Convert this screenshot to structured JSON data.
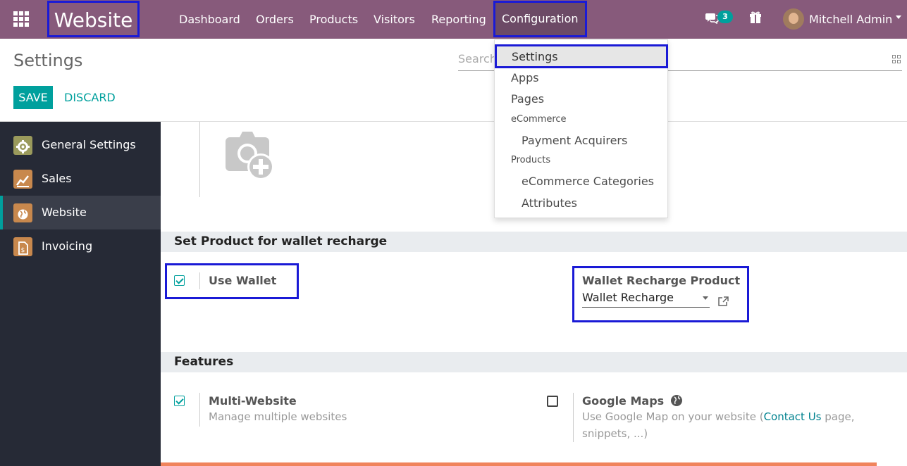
{
  "navbar": {
    "app_title": "Website",
    "menu": [
      "Dashboard",
      "Orders",
      "Products",
      "Visitors",
      "Reporting",
      "Configuration"
    ],
    "active_menu": "Configuration",
    "messages_count": "3",
    "user_name": "Mitchell Admin",
    "accent_color": "#875a7b"
  },
  "control_panel": {
    "title": "Settings",
    "search_placeholder": "Search...",
    "save_label": "SAVE",
    "discard_label": "DISCARD"
  },
  "sidebar": {
    "items": [
      {
        "label": "General Settings",
        "icon": "gear-icon"
      },
      {
        "label": "Sales",
        "icon": "chart-icon"
      },
      {
        "label": "Website",
        "icon": "globe-icon",
        "active": true
      },
      {
        "label": "Invoicing",
        "icon": "invoice-icon"
      }
    ]
  },
  "dropdown": {
    "items": [
      {
        "label": "Settings",
        "type": "item",
        "highlighted": true
      },
      {
        "label": "Apps",
        "type": "item"
      },
      {
        "label": "Pages",
        "type": "item"
      },
      {
        "label": "eCommerce",
        "type": "header"
      },
      {
        "label": "Payment Acquirers",
        "type": "subitem"
      },
      {
        "label": "Products",
        "type": "header"
      },
      {
        "label": "eCommerce Categories",
        "type": "subitem"
      },
      {
        "label": "Attributes",
        "type": "subitem"
      }
    ]
  },
  "wallet_section": {
    "heading": "Set Product for wallet recharge",
    "use_wallet_label": "Use Wallet",
    "use_wallet_checked": true,
    "recharge_product_label": "Wallet Recharge Product",
    "recharge_product_value": "Wallet Recharge"
  },
  "features_section": {
    "heading": "Features",
    "multi_website": {
      "title": "Multi-Website",
      "description": "Manage multiple websites",
      "checked": true
    },
    "google_maps": {
      "title": "Google Maps",
      "description_pre": "Use Google Map on your website (",
      "description_link": "Contact Us",
      "description_post": " page, snippets, ...)",
      "checked": false
    }
  },
  "colors": {
    "primary": "#00a09d",
    "highlight_border": "#1a1ad6",
    "sidebar_bg": "#262a36"
  }
}
